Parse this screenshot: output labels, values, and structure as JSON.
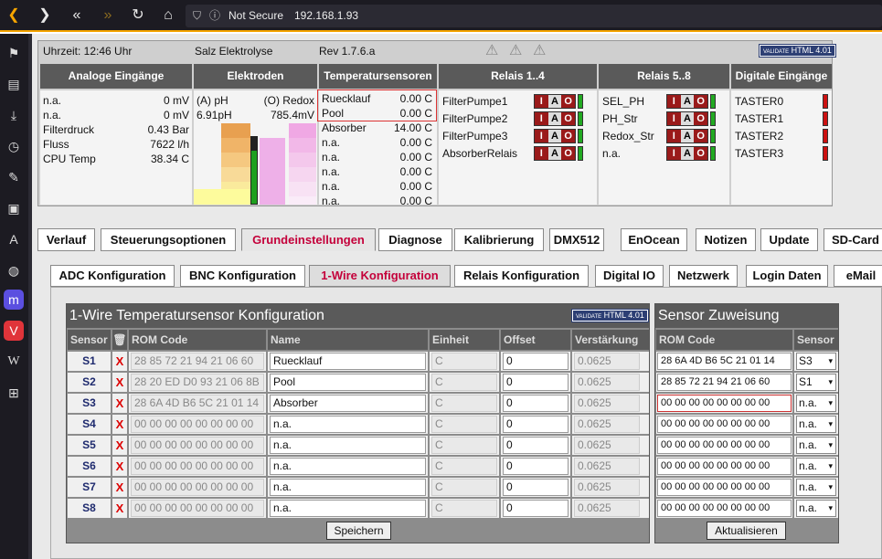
{
  "browser": {
    "security": "Not Secure",
    "url": "192.168.1.93"
  },
  "status": {
    "time": "Uhrzeit: 12:46 Uhr",
    "device": "Salz Elektrolyse",
    "revision": "Rev 1.7.6.a",
    "html_badge": "HTML 4.01",
    "badge_logo": "VALIDATE",
    "headers": {
      "analog": "Analoge Eingänge",
      "electrodes": "Elektroden",
      "temp": "Temperatursensoren",
      "relais14": "Relais 1..4",
      "relais58": "Relais 5..8",
      "digital": "Digitale Eingänge"
    },
    "analog": [
      {
        "label": "n.a.",
        "value": "0 mV"
      },
      {
        "label": "n.a.",
        "value": "0 mV"
      },
      {
        "label": "Filterdruck",
        "value": "0.43 Bar"
      },
      {
        "label": "Fluss",
        "value": "7622 l/h"
      },
      {
        "label": "CPU Temp",
        "value": "38.34 C"
      }
    ],
    "electrodes": {
      "ph_label": "(A) pH",
      "redox_label": "(O) Redox",
      "ph_value": "6.91pH",
      "redox_value": "785.4mV"
    },
    "temps": [
      {
        "label": "Ruecklauf",
        "value": "0.00 C"
      },
      {
        "label": "Pool",
        "value": "0.00 C"
      },
      {
        "label": "Absorber",
        "value": "14.00 C"
      },
      {
        "label": "n.a.",
        "value": "0.00 C"
      },
      {
        "label": "n.a.",
        "value": "0.00 C"
      },
      {
        "label": "n.a.",
        "value": "0.00 C"
      },
      {
        "label": "n.a.",
        "value": "0.00 C"
      },
      {
        "label": "n.a.",
        "value": "0.00 C"
      }
    ],
    "relais14": [
      "FilterPumpe1",
      "FilterPumpe2",
      "FilterPumpe3",
      "AbsorberRelais"
    ],
    "relais58": [
      "SEL_PH",
      "PH_Str",
      "Redox_Str",
      "n.a."
    ],
    "iao": {
      "i": "I",
      "a": "A",
      "o": "O"
    },
    "digital": [
      "TASTER0",
      "TASTER1",
      "TASTER2",
      "TASTER3"
    ],
    "colors": {
      "led_on": "#22aa22",
      "led_off": "#cc1111"
    }
  },
  "tabs": [
    "Verlauf",
    "Steuerungsoptionen",
    "Grundeinstellungen",
    "Diagnose",
    "Kalibrierung",
    "DMX512",
    "EnOcean",
    "Notizen",
    "Update",
    "SD-Card"
  ],
  "subtabs": [
    "ADC Konfiguration",
    "BNC Konfiguration",
    "1-Wire Konfiguration",
    "Relais Konfiguration",
    "Digital IO",
    "Netzwerk",
    "Login Daten",
    "eMail"
  ],
  "onewire": {
    "title": "1-Wire Temperatursensor Konfiguration",
    "columns": {
      "sensor": "Sensor",
      "rom": "ROM Code",
      "name": "Name",
      "unit": "Einheit",
      "offset": "Offset",
      "gain": "Verstärkung"
    },
    "rom_placeholder": "00 00 00 00 00 00 00 00",
    "rows": [
      {
        "id": "S1",
        "rom": "28 85 72 21 94 21 06 60",
        "name": "Ruecklauf",
        "unit": "C",
        "offset": "0",
        "gain": "0.0625"
      },
      {
        "id": "S2",
        "rom": "28 20 ED D0 93 21 06 8B",
        "name": "Pool",
        "unit": "C",
        "offset": "0",
        "gain": "0.0625"
      },
      {
        "id": "S3",
        "rom": "28 6A 4D B6 5C 21 01 14",
        "name": "Absorber",
        "unit": "C",
        "offset": "0",
        "gain": "0.0625"
      },
      {
        "id": "S4",
        "rom": "",
        "name": "n.a.",
        "unit": "C",
        "offset": "0",
        "gain": "0.0625"
      },
      {
        "id": "S5",
        "rom": "",
        "name": "n.a.",
        "unit": "C",
        "offset": "0",
        "gain": "0.0625"
      },
      {
        "id": "S6",
        "rom": "",
        "name": "n.a.",
        "unit": "C",
        "offset": "0",
        "gain": "0.0625"
      },
      {
        "id": "S7",
        "rom": "",
        "name": "n.a.",
        "unit": "C",
        "offset": "0",
        "gain": "0.0625"
      },
      {
        "id": "S8",
        "rom": "",
        "name": "n.a.",
        "unit": "C",
        "offset": "0",
        "gain": "0.0625"
      }
    ],
    "delete_mark": "X",
    "save_label": "Speichern"
  },
  "assign": {
    "title": "Sensor Zuweisung",
    "col_rom": "ROM Code",
    "col_sensor": "Sensor",
    "rows": [
      {
        "rom": "28 6A 4D B6 5C 21 01 14",
        "sensor": "S3"
      },
      {
        "rom": "28 85 72 21 94 21 06 60",
        "sensor": "S1"
      },
      {
        "rom": "00 00 00 00 00 00 00 00",
        "sensor": "n.a."
      },
      {
        "rom": "00 00 00 00 00 00 00 00",
        "sensor": "n.a."
      },
      {
        "rom": "00 00 00 00 00 00 00 00",
        "sensor": "n.a."
      },
      {
        "rom": "00 00 00 00 00 00 00 00",
        "sensor": "n.a."
      },
      {
        "rom": "00 00 00 00 00 00 00 00",
        "sensor": "n.a."
      },
      {
        "rom": "00 00 00 00 00 00 00 00",
        "sensor": "n.a."
      }
    ],
    "refresh_label": "Aktualisieren"
  }
}
